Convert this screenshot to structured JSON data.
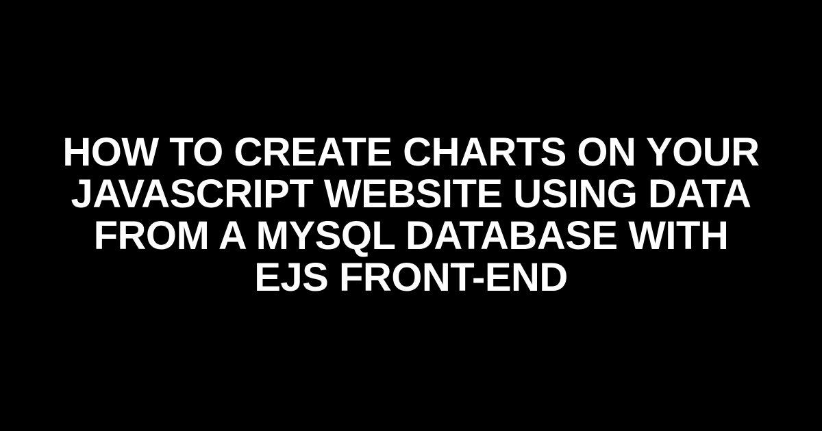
{
  "title": "How to Create Charts on Your JavaScript Website Using Data from a MySQL Database with EJS Front-End"
}
